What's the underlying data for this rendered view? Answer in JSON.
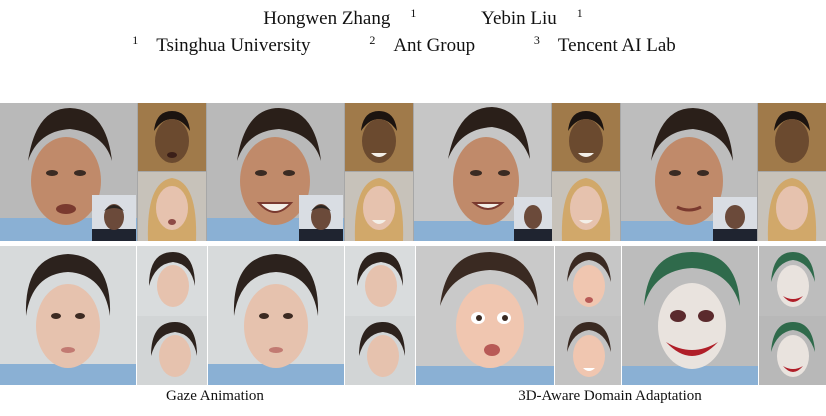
{
  "authors": [
    {
      "name": "Hongwen Zhang",
      "mark": "1"
    },
    {
      "name": "Yebin Liu",
      "mark": "1"
    }
  ],
  "affiliations": [
    {
      "mark": "1",
      "name": "Tsinghua University"
    },
    {
      "mark": "2",
      "name": "Ant Group"
    },
    {
      "mark": "3",
      "name": "Tencent AI Lab"
    }
  ],
  "captions": {
    "left": "Gaze Animation",
    "right": "3D-Aware Domain Adaptation"
  },
  "colors": {
    "skin_male": "#c08a6a",
    "hair_dark": "#2a1f19",
    "skin_female": "#e6c2ae",
    "joker_skin": "#e9e3de",
    "joker_hair": "#2f6a4b",
    "shirt_blue": "#8ab0d4"
  }
}
